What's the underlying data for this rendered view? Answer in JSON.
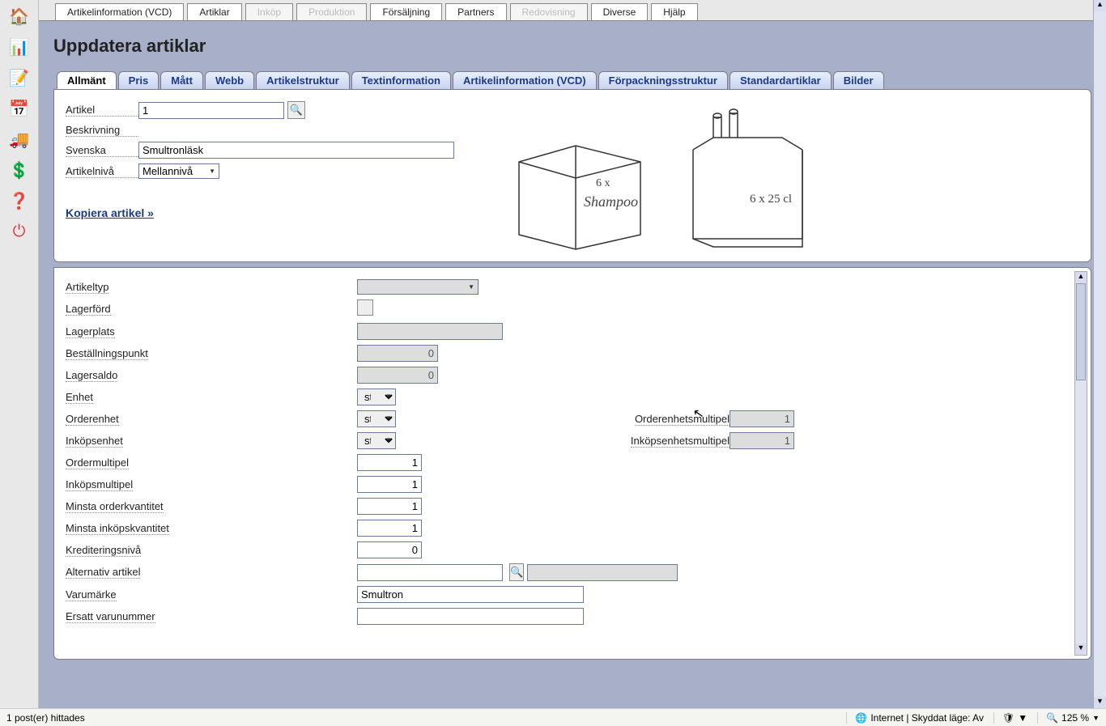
{
  "leftIcons": [
    "home-icon",
    "chart-icon",
    "note-icon",
    "calendar-icon",
    "truck-icon",
    "dollar-icon",
    "help-icon",
    "power-icon"
  ],
  "topTabs": [
    {
      "label": "Artikelinformation (VCD)",
      "disabled": false
    },
    {
      "label": "Artiklar",
      "disabled": false
    },
    {
      "label": "Inköp",
      "disabled": true
    },
    {
      "label": "Produktion",
      "disabled": true
    },
    {
      "label": "Försäljning",
      "disabled": false
    },
    {
      "label": "Partners",
      "disabled": false
    },
    {
      "label": "Redovisning",
      "disabled": true
    },
    {
      "label": "Diverse",
      "disabled": false
    },
    {
      "label": "Hjälp",
      "disabled": false
    }
  ],
  "pageTitle": "Uppdatera artiklar",
  "subTabs": [
    "Allmänt",
    "Pris",
    "Mått",
    "Webb",
    "Artikelstruktur",
    "Textinformation",
    "Artikelinformation (VCD)",
    "Förpackningsstruktur",
    "Standardartiklar",
    "Bilder"
  ],
  "activeSubTab": 0,
  "upper": {
    "artikelLabel": "Artikel",
    "artikelValue": "1",
    "beskrivningLabel": "Beskrivning",
    "svenskaLabel": "Svenska",
    "svenskaValue": "Smultronläsk",
    "nivåLabel": "Artikelnivå",
    "nivåValue": "Mellannivå",
    "copyLink": "Kopiera artikel »",
    "boxText1": "6 x",
    "boxText2": "Shampoo",
    "pack1": "6 x 25 cl"
  },
  "lower": {
    "artikeltyp": {
      "label": "Artikeltyp",
      "value": ""
    },
    "lagerford": {
      "label": "Lagerförd",
      "checked": false
    },
    "lagerplats": {
      "label": "Lagerplats",
      "value": ""
    },
    "bestallningspunkt": {
      "label": "Beställningspunkt",
      "value": "0"
    },
    "lagersaldo": {
      "label": "Lagersaldo",
      "value": "0"
    },
    "enhet": {
      "label": "Enhet",
      "value": "st"
    },
    "orderenhet": {
      "label": "Orderenhet",
      "value": "st"
    },
    "orderenhetsmultipel": {
      "label": "Orderenhetsmultipel",
      "value": "1"
    },
    "inkopsenhet": {
      "label": "Inköpsenhet",
      "value": "st"
    },
    "inkopsenhetsmultipel": {
      "label": "Inköpsenhetsmultipel",
      "value": "1"
    },
    "ordermultipel": {
      "label": "Ordermultipel",
      "value": "1"
    },
    "inkopsmultipel": {
      "label": "Inköpsmultipel",
      "value": "1"
    },
    "minstaorder": {
      "label": "Minsta orderkvantitet",
      "value": "1"
    },
    "minstainkop": {
      "label": "Minsta inköpskvantitet",
      "value": "1"
    },
    "krediteringsniva": {
      "label": "Krediteringsnivå",
      "value": "0"
    },
    "altartikel": {
      "label": "Alternativ artikel",
      "value": ""
    },
    "varumarke": {
      "label": "Varumärke",
      "value": "Smultron"
    },
    "ersatt": {
      "label": "Ersatt varunummer",
      "value": ""
    }
  },
  "status": {
    "left": "1 post(er) hittades",
    "internet": "Internet | Skyddat läge: Av",
    "zoom": "125 %"
  }
}
